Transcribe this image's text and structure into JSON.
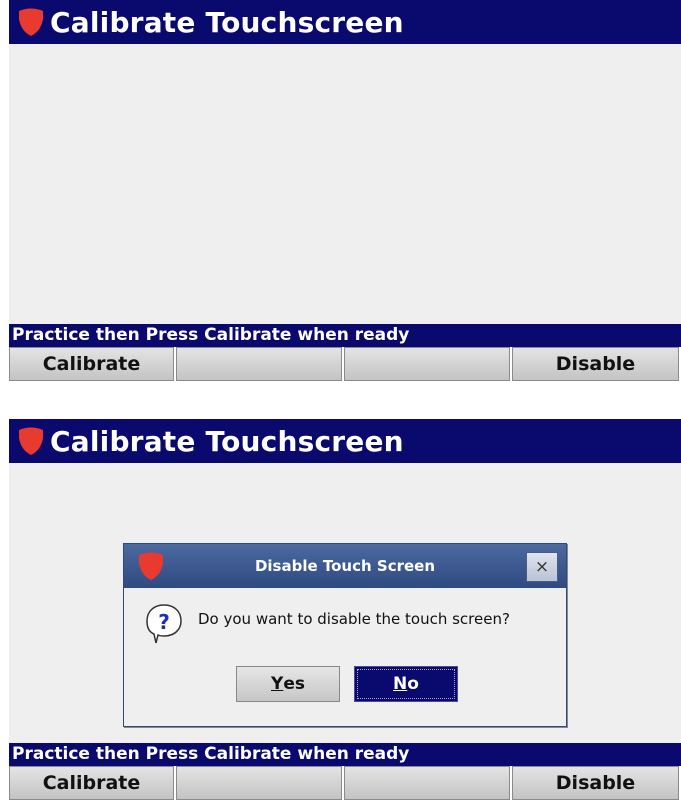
{
  "screens": [
    {
      "title": "Calibrate Touchscreen",
      "status": "Practice then Press Calibrate when ready",
      "softkeys": [
        "Calibrate",
        "",
        "",
        "Disable"
      ]
    },
    {
      "title": "Calibrate Touchscreen",
      "status": "Practice then Press Calibrate when ready",
      "softkeys": [
        "Calibrate",
        "",
        "",
        "Disable"
      ],
      "dialog": {
        "title": "Disable Touch Screen",
        "message": "Do you want to disable the touch screen?",
        "yes_mnemonic": "Y",
        "yes_rest": "es",
        "no_mnemonic": "N",
        "no_rest": "o",
        "close_glyph": "×"
      }
    }
  ],
  "colors": {
    "titlebar": "#0a0a6e",
    "logo_red": "#e83a2f",
    "content_bg": "#efefef",
    "dialog_title_bg": "#3b5890"
  },
  "icons": {
    "app_logo": "red-shield-icon",
    "question": "question-bubble-icon",
    "close": "close-icon"
  }
}
